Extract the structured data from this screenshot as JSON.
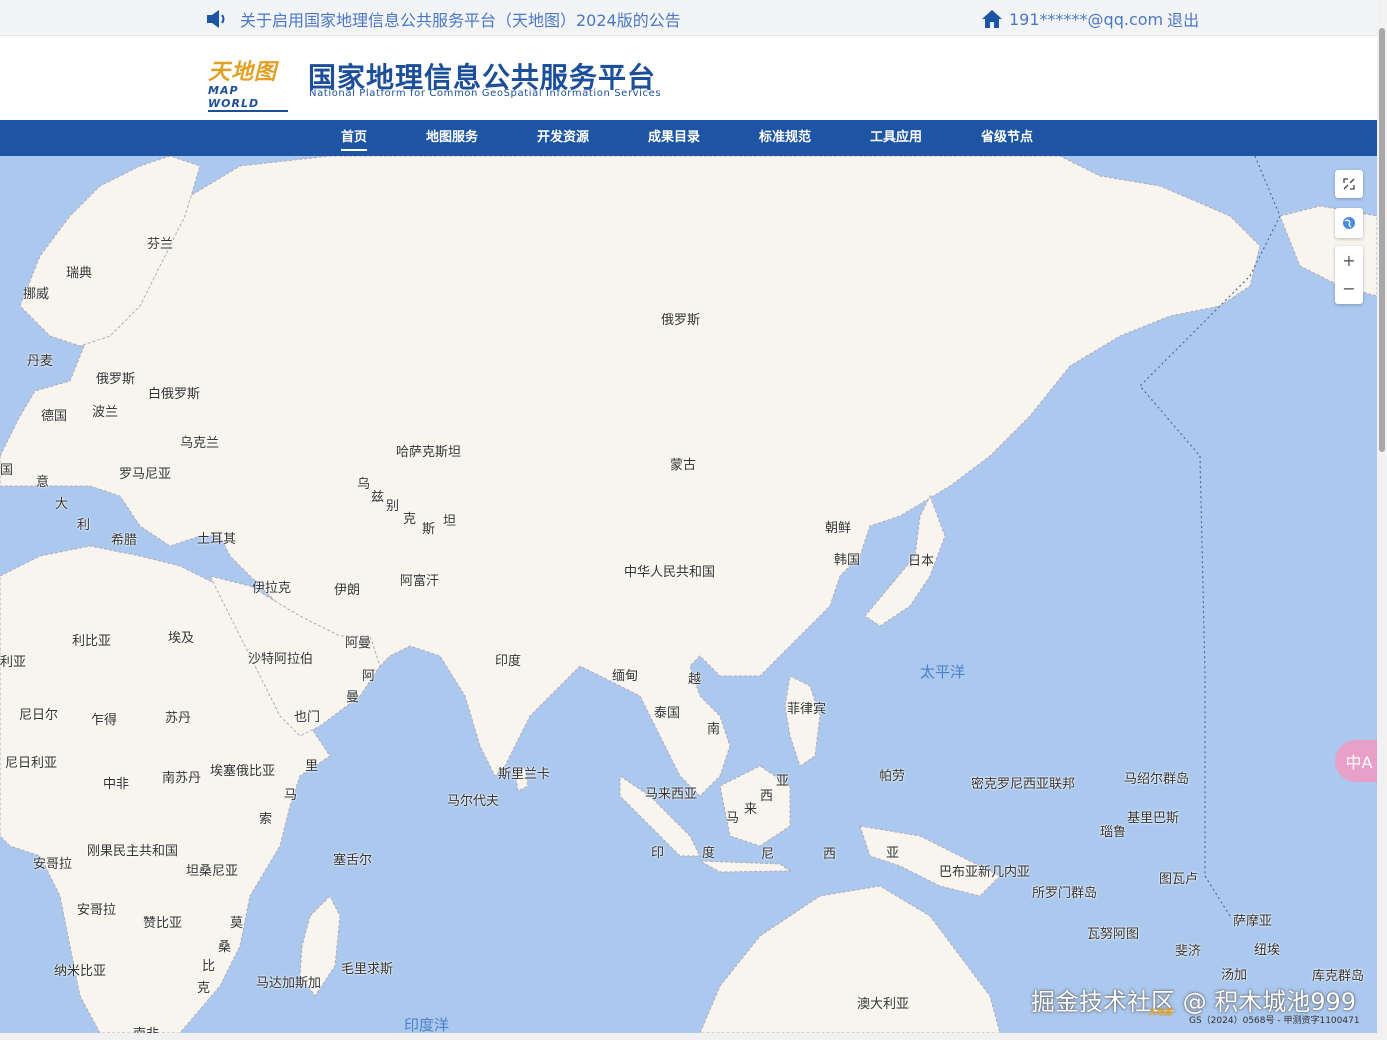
{
  "notice": {
    "text": "关于启用国家地理信息公共服务平台（天地图）2024版的公告"
  },
  "user": {
    "email": "191******@qq.com",
    "logout": "退出"
  },
  "header": {
    "logo_cn": "天地图",
    "logo_en": "MAP WORLD",
    "title": "国家地理信息公共服务平台",
    "subtitle": "National Platform for Common GeoSpatial Information Services"
  },
  "nav": [
    "首页",
    "地图服务",
    "开发资源",
    "成果目录",
    "标准规范",
    "工具应用",
    "省级节点"
  ],
  "nav_active_index": 0,
  "map": {
    "labels": [
      "芬兰",
      "瑞典",
      "挪威",
      "丹麦",
      "俄罗斯",
      "白俄罗斯",
      "德国",
      "波兰",
      "乌克兰",
      "罗马尼亚",
      "意",
      "大",
      "利",
      "希腊",
      "土耳其",
      "哈萨克斯坦",
      "乌",
      "兹",
      "别",
      "克",
      "斯",
      "坦",
      "蒙古",
      "俄罗斯",
      "朝鲜",
      "韩国",
      "日本",
      "中华人民共和国",
      "伊拉克",
      "伊朗",
      "阿富汗",
      "利比亚",
      "埃及",
      "沙特阿拉伯",
      "阿曼",
      "阿",
      "曼",
      "印度",
      "缅甸",
      "越",
      "泰国",
      "南",
      "菲律宾",
      "尼日尔",
      "乍得",
      "苏丹",
      "也门",
      "尼日利亚",
      "埃塞俄比亚",
      "里",
      "马",
      "中非",
      "南苏丹",
      "索",
      "斯里兰卡",
      "马尔代夫",
      "马来西亚",
      "亚",
      "西",
      "来",
      "马",
      "帕劳",
      "密克罗尼西亚联邦",
      "马绍尔群岛",
      "基里巴斯",
      "瑙鲁",
      "印",
      "度",
      "尼",
      "西",
      "亚",
      "巴布亚新几内亚",
      "所罗门群岛",
      "图瓦卢",
      "刚果民主共和国",
      "安哥拉",
      "坦桑尼亚",
      "塞舌尔",
      "安哥拉",
      "赞比亚",
      "莫",
      "桑",
      "比",
      "克",
      "纳米比亚",
      "马达加斯加",
      "毛里求斯",
      "瓦努阿图",
      "斐济",
      "萨摩亚",
      "纽埃",
      "汤加",
      "库克群岛",
      "澳大利亚",
      "南非",
      "利亚",
      "国"
    ],
    "oceans": [
      "太平洋",
      "印度洋"
    ],
    "watermark": "掘金技术社区 @ 积木城池999",
    "mini_logo": "天地图",
    "copyright": "GS（2024）0568号 - 甲测资字1100471",
    "controls": [
      "fullscreen-icon",
      "globe-icon",
      "+",
      "−"
    ],
    "translate_label": "中A"
  },
  "colors": {
    "nav_bg": "#1d54a3",
    "ocean": "#abc8ef",
    "land": "#f7f5ee",
    "link": "#4a78c8",
    "title": "#1c4f9a"
  }
}
